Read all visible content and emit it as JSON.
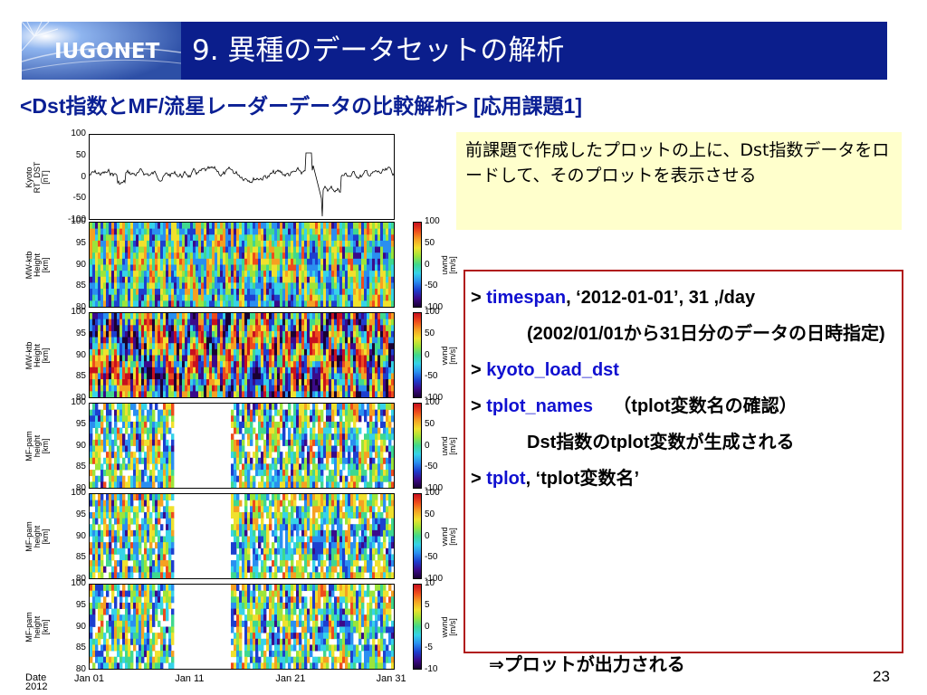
{
  "header": {
    "logo_text": "IUGONET",
    "title": "9. 異種のデータセットの解析"
  },
  "subtitle": "<Dst指数とMF/流星レーダーデータの比較解析> [応用課題1]",
  "figure": {
    "panels": [
      {
        "id": "dst",
        "ylabel": [
          "Kyoto",
          "RT_DST",
          "[nT]"
        ],
        "yticks": [
          "100",
          "50",
          "0",
          "-50",
          "-100"
        ]
      },
      {
        "id": "mw-uwnd",
        "ylabel": [
          "MW-ktb",
          "Height",
          "[km]"
        ],
        "yticks": [
          "100",
          "95",
          "90",
          "85",
          "80"
        ],
        "cbar_label": [
          "uwnd",
          "[m/s]"
        ],
        "cbar_ticks": [
          "100",
          "50",
          "0",
          "-50",
          "-100"
        ]
      },
      {
        "id": "mw-vwnd",
        "ylabel": [
          "MW-ktb",
          "Height",
          "[km]"
        ],
        "yticks": [
          "100",
          "95",
          "90",
          "85",
          "80"
        ],
        "cbar_label": [
          "vwnd",
          "[m/s]"
        ],
        "cbar_ticks": [
          "100",
          "50",
          "0",
          "-50",
          "-100"
        ]
      },
      {
        "id": "mf-uwnd",
        "ylabel": [
          "MF-pam",
          "height",
          "[km]"
        ],
        "yticks": [
          "100",
          "95",
          "90",
          "85",
          "80"
        ],
        "cbar_label": [
          "uwnd",
          "[m/s]"
        ],
        "cbar_ticks": [
          "100",
          "50",
          "0",
          "-50",
          "-100"
        ]
      },
      {
        "id": "mf-vwnd",
        "ylabel": [
          "MF-pam",
          "height",
          "[km]"
        ],
        "yticks": [
          "100",
          "95",
          "90",
          "85",
          "80"
        ],
        "cbar_label": [
          "vwnd",
          "[m/s]"
        ],
        "cbar_ticks": [
          "100",
          "50",
          "0",
          "-50",
          "-100"
        ]
      },
      {
        "id": "mf-wwnd",
        "ylabel": [
          "MF-pam",
          "height",
          "[km]"
        ],
        "yticks": [
          "100",
          "95",
          "90",
          "85",
          "80"
        ],
        "cbar_label": [
          "wwnd",
          "[m/s]"
        ],
        "cbar_ticks": [
          "10",
          "5",
          "0",
          "-5",
          "-10"
        ]
      }
    ],
    "xticks": [
      "Jan 01",
      "Jan 11",
      "Jan 21",
      "Jan 31"
    ],
    "xaxis_label": [
      "Date",
      "2012"
    ]
  },
  "note": "前課題で作成したプロットの上に、Dst指数データをロードして、そのプロットを表示させる",
  "commands": {
    "line1_prompt": ">",
    "line1_cmd": "timespan",
    "line1_args": ", ‘2012-01-01’, 31 ,/day",
    "line2": "(2002/01/01から31日分のデータの日時指定)",
    "line3_prompt": ">",
    "line3_cmd": "kyoto_load_dst",
    "line4_prompt": ">",
    "line4_cmd": "tplot_names",
    "line4_note": "（tplot変数名の確認）",
    "line5": "Dst指数のtplot変数が生成される",
    "line6_prompt": ">",
    "line6_cmd": "tplot",
    "line6_args": ", ‘tplot変数名’"
  },
  "result_text": "⇒プロットが出力される",
  "page_number": "23"
}
